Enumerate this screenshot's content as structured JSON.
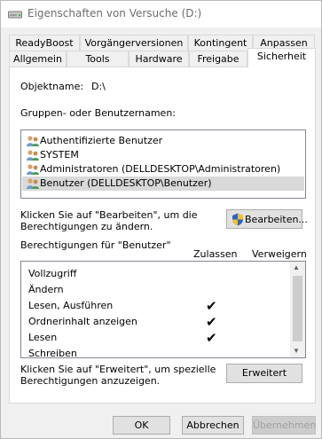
{
  "window": {
    "title": "Eigenschaften von Versuche (D:)"
  },
  "tabs_row1": [
    {
      "label": "ReadyBoost"
    },
    {
      "label": "Vorgängerversionen"
    },
    {
      "label": "Kontingent"
    },
    {
      "label": "Anpassen"
    }
  ],
  "tabs_row2": [
    {
      "label": "Allgemein"
    },
    {
      "label": "Tools"
    },
    {
      "label": "Hardware"
    },
    {
      "label": "Freigabe"
    },
    {
      "label": "Sicherheit"
    }
  ],
  "object": {
    "label": "Objektname:",
    "value": "D:\\"
  },
  "groups": {
    "label": "Gruppen- oder Benutzernamen:",
    "items": [
      {
        "name": "Authentifizierte Benutzer"
      },
      {
        "name": "SYSTEM"
      },
      {
        "name": "Administratoren (DELLDESKTOP\\Administratoren)"
      },
      {
        "name": "Benutzer (DELLDESKTOP\\Benutzer)"
      }
    ],
    "selected_index": 3
  },
  "edit": {
    "hint_line1": "Klicken Sie auf \"Bearbeiten\", um die",
    "hint_line2": "Berechtigungen zu ändern.",
    "button": "Bearbeiten..."
  },
  "permissions": {
    "title": "Berechtigungen für \"Benutzer\"",
    "col_allow": "Zulassen",
    "col_deny": "Verweigern",
    "rows": [
      {
        "name": "Vollzugriff",
        "allow": false,
        "deny": false
      },
      {
        "name": "Ändern",
        "allow": false,
        "deny": false
      },
      {
        "name": "Lesen, Ausführen",
        "allow": true,
        "deny": false
      },
      {
        "name": "Ordnerinhalt anzeigen",
        "allow": true,
        "deny": false
      },
      {
        "name": "Lesen",
        "allow": true,
        "deny": false
      },
      {
        "name": "Schreiben",
        "allow": false,
        "deny": false
      }
    ],
    "check_glyph": "✔"
  },
  "advanced": {
    "hint_line1": "Klicken Sie auf \"Erweitert\", um spezielle",
    "hint_line2": "Berechtigungen anzuzeigen.",
    "button": "Erweitert"
  },
  "footer": {
    "ok": "OK",
    "cancel": "Abbrechen",
    "apply": "Übernehmen"
  }
}
